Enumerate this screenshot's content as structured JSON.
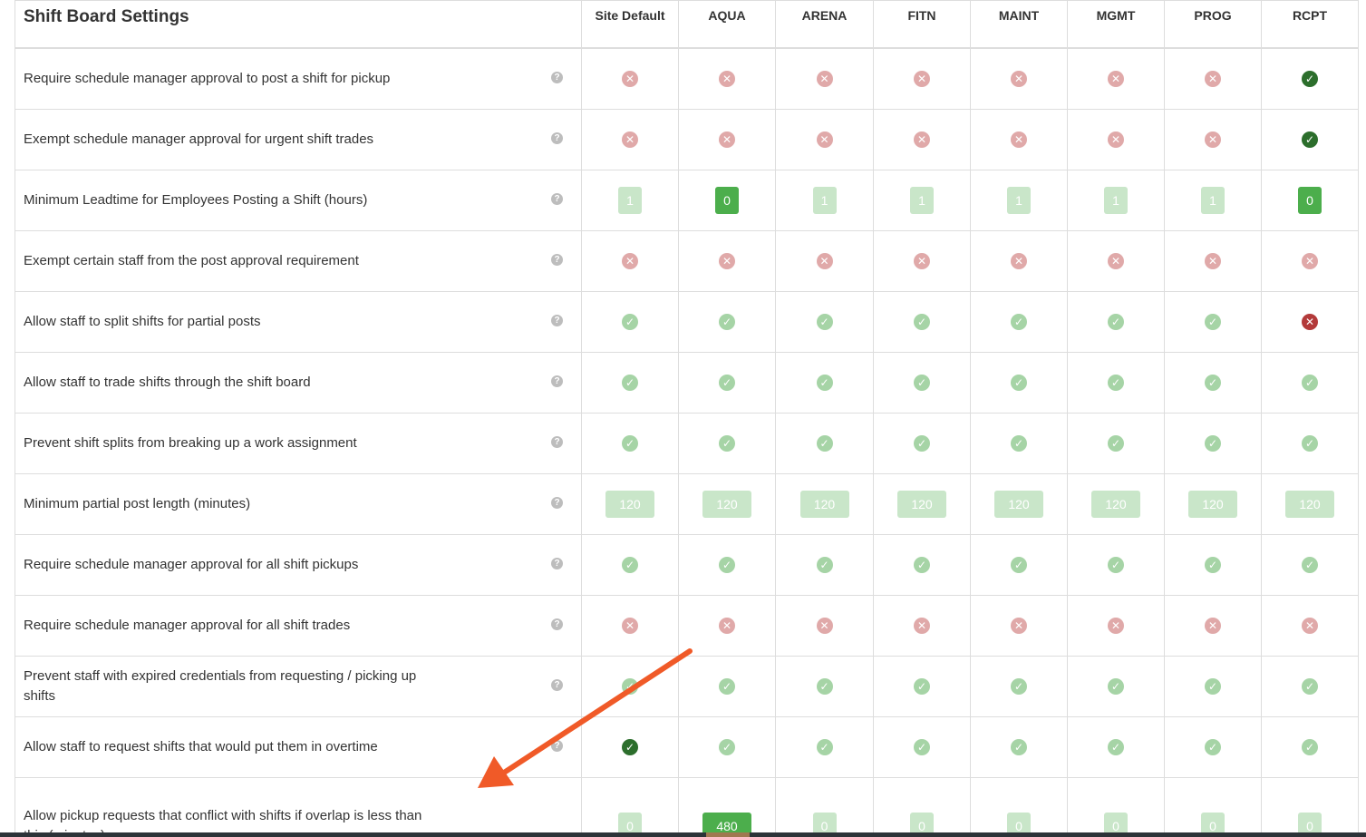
{
  "title": "Shift Board Settings",
  "columns": [
    "Site Default",
    "AQUA",
    "ARENA",
    "FITN",
    "MAINT",
    "MGMT",
    "PROG",
    "RCPT"
  ],
  "help_icon_glyph": "?",
  "colors": {
    "disabled_x": "#e0a9a9",
    "disabled_check": "#a6d4a6",
    "active_check": "#2c6e2c",
    "active_x": "#b33a3a",
    "active_badge": "#4cae4c",
    "inactive_badge": "#c9e6c9",
    "annotation_arrow": "#f05a28"
  },
  "rows": [
    {
      "label": "Require schedule manager approval to post a shift for pickup",
      "type": "bool",
      "cells": [
        "off",
        "off",
        "off",
        "off",
        "off",
        "off",
        "off",
        "on-active"
      ]
    },
    {
      "label": "Exempt schedule manager approval for urgent shift trades",
      "type": "bool",
      "cells": [
        "off",
        "off",
        "off",
        "off",
        "off",
        "off",
        "off",
        "on-active"
      ]
    },
    {
      "label": "Minimum Leadtime for Employees Posting a Shift (hours)",
      "type": "num",
      "cells": [
        {
          "v": "1",
          "a": false
        },
        {
          "v": "0",
          "a": true
        },
        {
          "v": "1",
          "a": false
        },
        {
          "v": "1",
          "a": false
        },
        {
          "v": "1",
          "a": false
        },
        {
          "v": "1",
          "a": false
        },
        {
          "v": "1",
          "a": false
        },
        {
          "v": "0",
          "a": true
        }
      ]
    },
    {
      "label": "Exempt certain staff from the post approval requirement",
      "type": "bool",
      "cells": [
        "off",
        "off",
        "off",
        "off",
        "off",
        "off",
        "off",
        "off"
      ]
    },
    {
      "label": "Allow staff to split shifts for partial posts",
      "type": "bool",
      "cells": [
        "on",
        "on",
        "on",
        "on",
        "on",
        "on",
        "on",
        "off-active"
      ]
    },
    {
      "label": "Allow staff to trade shifts through the shift board",
      "type": "bool",
      "cells": [
        "on",
        "on",
        "on",
        "on",
        "on",
        "on",
        "on",
        "on"
      ]
    },
    {
      "label": "Prevent shift splits from breaking up a work assignment",
      "type": "bool",
      "cells": [
        "on",
        "on",
        "on",
        "on",
        "on",
        "on",
        "on",
        "on"
      ]
    },
    {
      "label": "Minimum partial post length (minutes)",
      "type": "num",
      "cells": [
        {
          "v": "120",
          "a": false
        },
        {
          "v": "120",
          "a": false
        },
        {
          "v": "120",
          "a": false
        },
        {
          "v": "120",
          "a": false
        },
        {
          "v": "120",
          "a": false
        },
        {
          "v": "120",
          "a": false
        },
        {
          "v": "120",
          "a": false
        },
        {
          "v": "120",
          "a": false
        }
      ]
    },
    {
      "label": "Require schedule manager approval for all shift pickups",
      "type": "bool",
      "cells": [
        "on",
        "on",
        "on",
        "on",
        "on",
        "on",
        "on",
        "on"
      ]
    },
    {
      "label": "Require schedule manager approval for all shift trades",
      "type": "bool",
      "cells": [
        "off",
        "off",
        "off",
        "off",
        "off",
        "off",
        "off",
        "off"
      ]
    },
    {
      "label": "Prevent staff with expired credentials from requesting / picking up shifts",
      "type": "bool",
      "cells": [
        "on",
        "on",
        "on",
        "on",
        "on",
        "on",
        "on",
        "on"
      ]
    },
    {
      "label": "Allow staff to request shifts that would put them in overtime",
      "type": "bool",
      "cells": [
        "on-active",
        "on",
        "on",
        "on",
        "on",
        "on",
        "on",
        "on"
      ]
    },
    {
      "label": "Allow pickup requests that conflict with shifts if overlap is less than this (minutes)",
      "type": "num",
      "cells": [
        {
          "v": "0",
          "a": false
        },
        {
          "v": "480",
          "a": true
        },
        {
          "v": "0",
          "a": false
        },
        {
          "v": "0",
          "a": false
        },
        {
          "v": "0",
          "a": false
        },
        {
          "v": "0",
          "a": false
        },
        {
          "v": "0",
          "a": false
        },
        {
          "v": "0",
          "a": false
        }
      ]
    }
  ]
}
